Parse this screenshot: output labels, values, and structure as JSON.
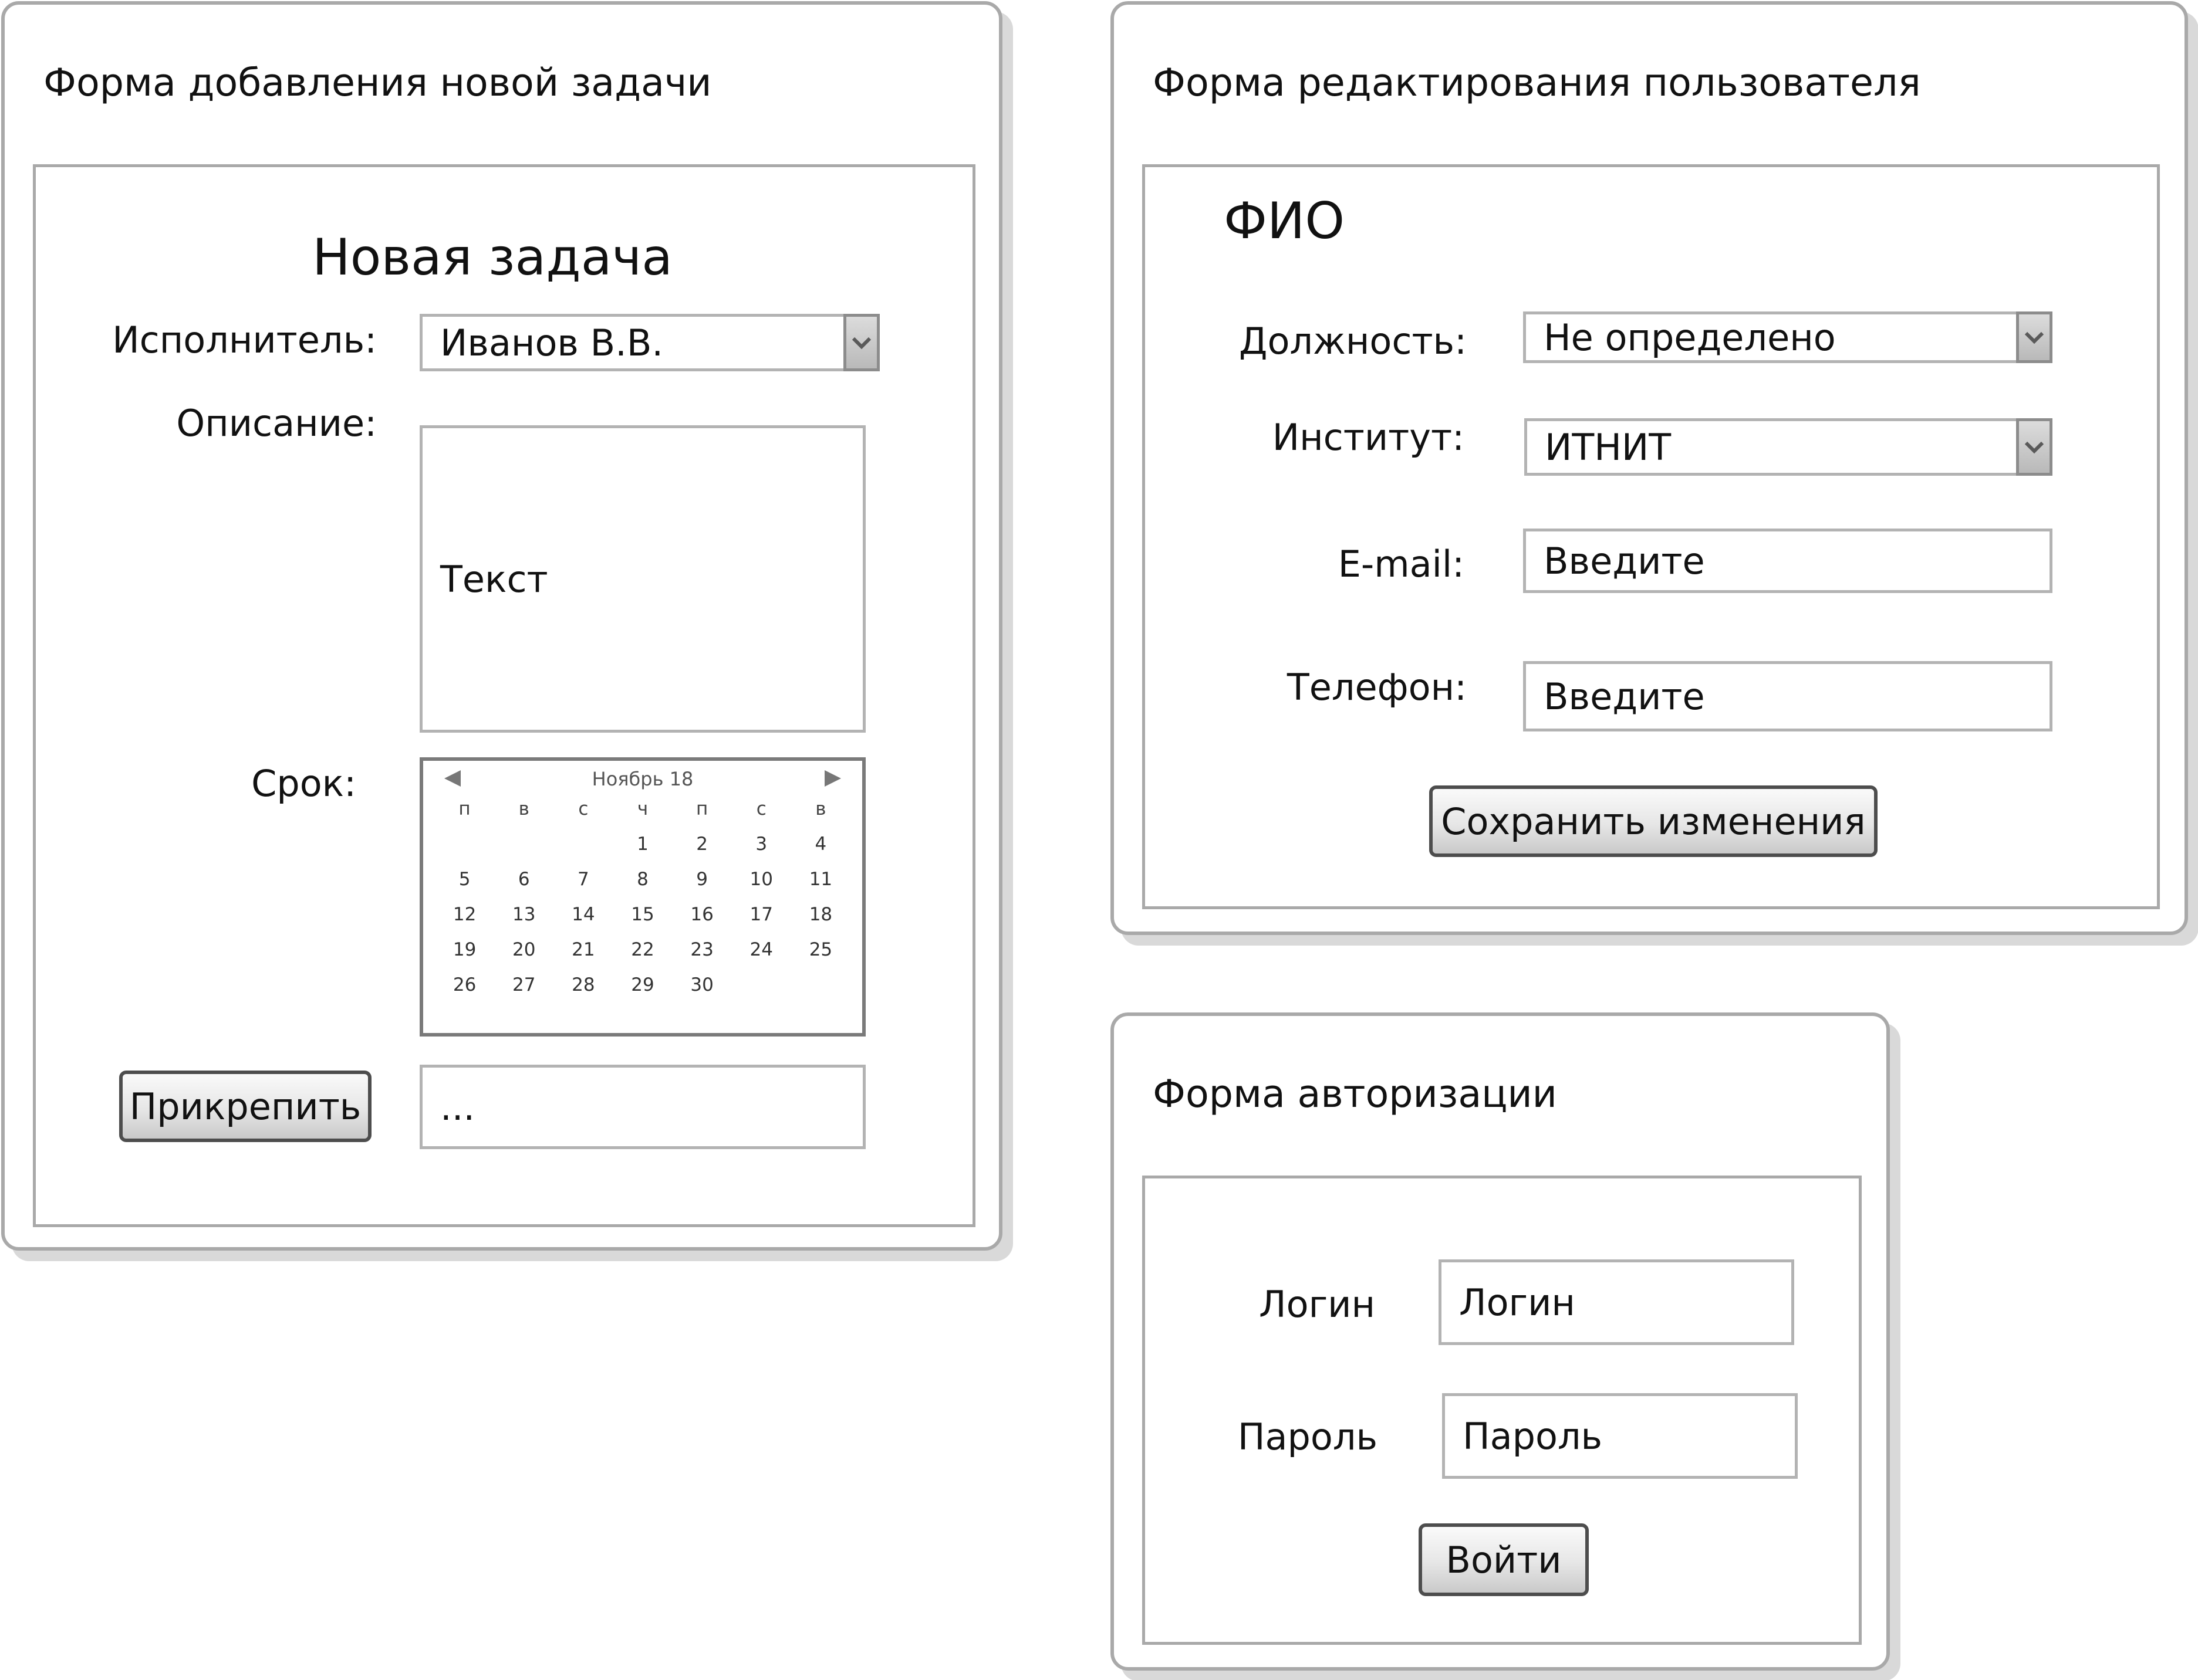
{
  "task_form": {
    "panel_title": "Форма добавления новой задачи",
    "heading": "Новая задача",
    "assignee_label": "Исполнитель:",
    "assignee_value": "Иванов В.В.",
    "description_label": "Описание:",
    "description_value": "Текст",
    "deadline_label": "Срок:",
    "calendar": {
      "month": "Ноябрь 18",
      "weekdays": [
        "п",
        "в",
        "с",
        "ч",
        "п",
        "с",
        "в"
      ],
      "days": [
        "",
        "",
        "",
        "1",
        "2",
        "3",
        "4",
        "5",
        "6",
        "7",
        "8",
        "9",
        "10",
        "11",
        "12",
        "13",
        "14",
        "15",
        "16",
        "17",
        "18",
        "19",
        "20",
        "21",
        "22",
        "23",
        "24",
        "25",
        "26",
        "27",
        "28",
        "29",
        "30",
        "",
        ""
      ]
    },
    "attach_button": "Прикрепить",
    "attach_value": "..."
  },
  "user_form": {
    "panel_title": "Форма редактирования пользователя",
    "heading": "ФИО",
    "position_label": "Должность:",
    "position_value": "Не определено",
    "institute_label": "Институт:",
    "institute_value": "ИТНИТ",
    "email_label": "E-mail:",
    "email_value": "Введите",
    "phone_label": "Телефон:",
    "phone_value": "Введите",
    "save_button": "Сохранить изменения"
  },
  "auth_form": {
    "panel_title": "Форма авторизации",
    "login_label": "Логин",
    "login_value": "Логин",
    "password_label": "Пароль",
    "password_value": "Пароль",
    "submit_button": "Войти"
  },
  "icons": {
    "dropdown": "chevron-down-icon",
    "prev_month": "triangle-left-icon",
    "next_month": "triangle-right-icon"
  }
}
